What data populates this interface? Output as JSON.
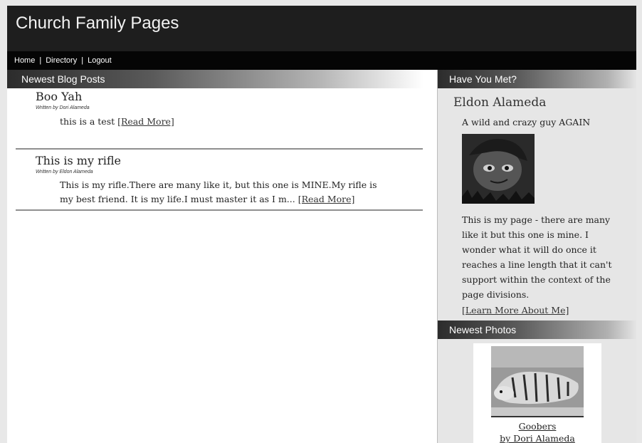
{
  "site": {
    "title": "Church Family Pages"
  },
  "nav": {
    "items": [
      "Home",
      "Directory",
      "Logout"
    ],
    "separator": "|"
  },
  "blog": {
    "heading": "Newest Blog Posts",
    "read_more_label": "[Read More]",
    "posts": [
      {
        "title": "Boo Yah",
        "byline": "Written by Dori Alameda",
        "excerpt": "this is a test"
      },
      {
        "title": "This is my rifle",
        "byline": "Written by Eldon Alameda",
        "excerpt_line1": "This is my rifle.There are many like it, but this one is MINE.My rifle is",
        "excerpt_line2": "my best friend. It is my life.I must master it as I m..."
      }
    ]
  },
  "sidebar": {
    "met_heading": "Have You Met?",
    "person": {
      "name": "Eldon Alameda",
      "tagline": "A wild and crazy guy AGAIN",
      "bio": "This is my page - there are many like it but this one is mine. I wonder what it will do once it reaches a line length that it can't support within the context of the page divisions.",
      "learn_more": "[Learn More About Me]"
    },
    "photos_heading": "Newest Photos",
    "photo": {
      "title": "Goobers",
      "byline": "by Dori Alameda"
    }
  },
  "icons": {
    "avatar": "cartoon-face-avatar",
    "photo": "tiger-photo"
  },
  "colors": {
    "header_bg": "#1e1e1e",
    "nav_bg": "#050505",
    "sidebar_bg": "#e6e6e6"
  }
}
